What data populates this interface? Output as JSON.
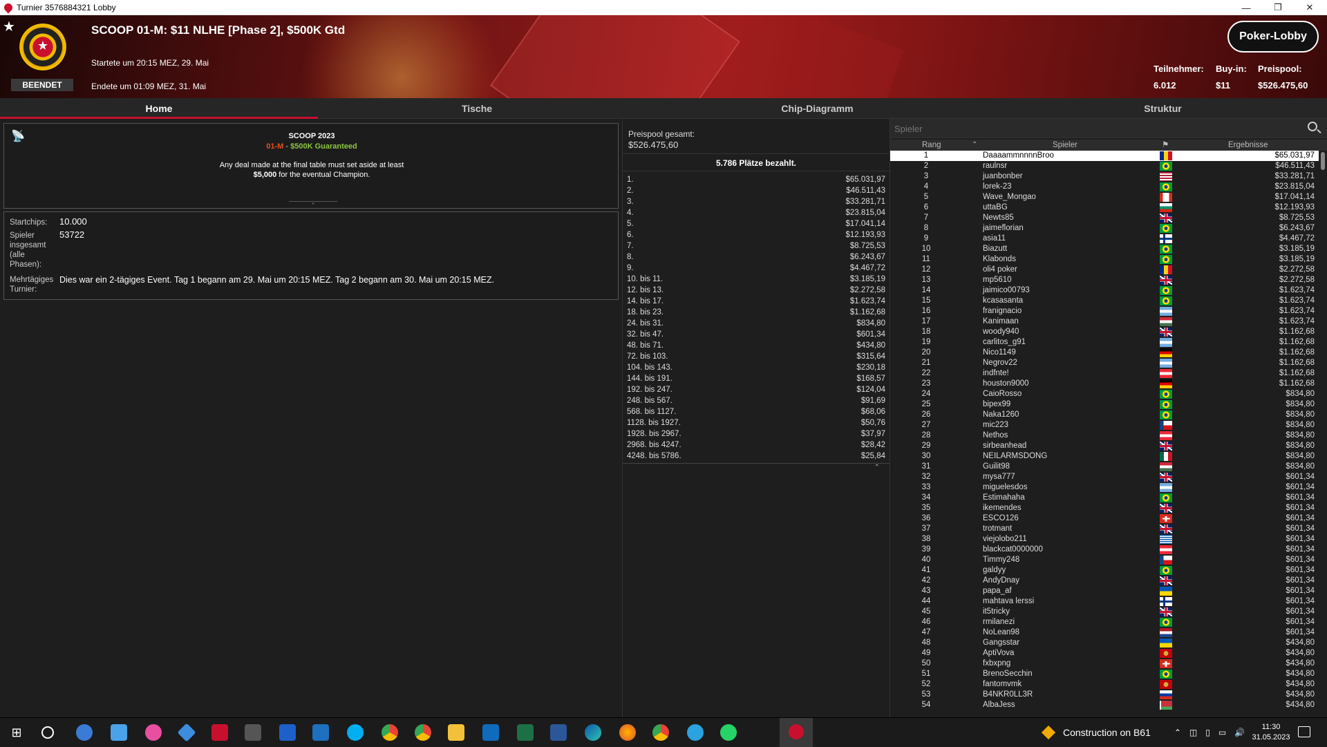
{
  "window": {
    "title": "Turnier 3576884321 Lobby"
  },
  "header": {
    "title": "SCOOP 01-M: $11 NLHE [Phase 2], $500K Gtd",
    "started": "Startete um 20:15 MEZ, 29. Mai",
    "ended": "Endete um 01:09 MEZ, 31. Mai",
    "status": "BEENDET",
    "lobby_button": "Poker-Lobby",
    "stats": {
      "players_label": "Teilnehmer:",
      "players_value": "6.012",
      "buyin_label": "Buy-in:",
      "buyin_value": "$11",
      "prizepool_label": "Preispool:",
      "prizepool_value": "$526.475,60"
    }
  },
  "tabs": [
    "Home",
    "Tische",
    "Chip-Diagramm",
    "Struktur"
  ],
  "info": {
    "line1": "SCOOP 2023",
    "line2_a": "01-M",
    "line2_b": "$500K Guaranteed",
    "line3": "Any deal made at the final table must set aside at least",
    "line4_bold": "$5,000",
    "line4_rest": " for the eventual Champion."
  },
  "details": {
    "startchips_label": "Startchips:",
    "startchips_value": "10.000",
    "players_label_1": "Spieler",
    "players_label_2": "insgesamt",
    "players_label_3": "(alle",
    "players_label_4": "Phasen):",
    "players_value": "53722",
    "multiday_label_1": "Mehrtägiges",
    "multiday_label_2": "Turnier:",
    "multiday_value": "Dies war ein 2-tägiges Event. Tag 1 begann am 29. Mai um 20:15 MEZ. Tag 2 begann am 30. Mai um 20:15 MEZ."
  },
  "prizepool": {
    "label": "Preispool gesamt:",
    "value": "$526.475,60",
    "paid": "5.786 Plätze bezahlt.",
    "rows": [
      [
        "1.",
        "$65.031,97"
      ],
      [
        "2.",
        "$46.511,43"
      ],
      [
        "3.",
        "$33.281,71"
      ],
      [
        "4.",
        "$23.815,04"
      ],
      [
        "5.",
        "$17.041,14"
      ],
      [
        "6.",
        "$12.193,93"
      ],
      [
        "7.",
        "$8.725,53"
      ],
      [
        "8.",
        "$6.243,67"
      ],
      [
        "9.",
        "$4.467,72"
      ],
      [
        "10. bis 11.",
        "$3.185,19"
      ],
      [
        "12. bis 13.",
        "$2.272,58"
      ],
      [
        "14. bis 17.",
        "$1.623,74"
      ],
      [
        "18. bis 23.",
        "$1.162,68"
      ],
      [
        "24. bis 31.",
        "$834,80"
      ],
      [
        "32. bis 47.",
        "$601,34"
      ],
      [
        "48. bis 71.",
        "$434,80"
      ],
      [
        "72. bis 103.",
        "$315,64"
      ],
      [
        "104. bis 143.",
        "$230,18"
      ],
      [
        "144. bis 191.",
        "$168,57"
      ],
      [
        "192. bis 247.",
        "$124,04"
      ],
      [
        "248. bis 567.",
        "$91,69"
      ],
      [
        "568. bis 1127.",
        "$68,06"
      ],
      [
        "1128. bis 1927.",
        "$50,76"
      ],
      [
        "1928. bis 2967.",
        "$37,97"
      ],
      [
        "2968. bis 4247.",
        "$28,42"
      ],
      [
        "4248. bis 5786.",
        "$25,84"
      ]
    ]
  },
  "players": {
    "search_placeholder": "Spieler",
    "col_rank": "Rang",
    "col_player": "Spieler",
    "col_result": "Ergebnisse",
    "rows": [
      [
        "1",
        "DaaaammnnnnBroo",
        "ro",
        "$65.031,97"
      ],
      [
        "2",
        "raulnsr",
        "br",
        "$46.511,43"
      ],
      [
        "3",
        "juanbonber",
        "us",
        "$33.281,71"
      ],
      [
        "4",
        "lorek-23",
        "br",
        "$23.815,04"
      ],
      [
        "5",
        "Wave_Mongao",
        "ca",
        "$17.041,14"
      ],
      [
        "6",
        "uttaBG",
        "bg",
        "$12.193,93"
      ],
      [
        "7",
        "Newts85",
        "gb",
        "$8.725,53"
      ],
      [
        "8",
        "jaimeflorian",
        "br",
        "$6.243,67"
      ],
      [
        "9",
        "asia11",
        "fi",
        "$4.467,72"
      ],
      [
        "10",
        "Biazutt",
        "br",
        "$3.185,19"
      ],
      [
        "11",
        "Klabonds",
        "br",
        "$3.185,19"
      ],
      [
        "12",
        "oli4 poker",
        "ro",
        "$2.272,58"
      ],
      [
        "13",
        "mp5610",
        "gb",
        "$2.272,58"
      ],
      [
        "14",
        "jaimico00793",
        "br",
        "$1.623,74"
      ],
      [
        "15",
        "kcasasanta",
        "br",
        "$1.623,74"
      ],
      [
        "16",
        "franignacio",
        "ar",
        "$1.623,74"
      ],
      [
        "17",
        "Kanimaan",
        "hu",
        "$1.623,74"
      ],
      [
        "18",
        "woody940",
        "gb",
        "$1.162,68"
      ],
      [
        "19",
        "carlitos_g91",
        "ar",
        "$1.162,68"
      ],
      [
        "20",
        "Nico1149",
        "de",
        "$1.162,68"
      ],
      [
        "21",
        "Negrov22",
        "ar",
        "$1.162,68"
      ],
      [
        "22",
        "indfnte!",
        "at",
        "$1.162,68"
      ],
      [
        "23",
        "houston9000",
        "de",
        "$1.162,68"
      ],
      [
        "24",
        "CaioRosso",
        "br",
        "$834,80"
      ],
      [
        "25",
        "bipex99",
        "br",
        "$834,80"
      ],
      [
        "26",
        "Naka1260",
        "br",
        "$834,80"
      ],
      [
        "27",
        "mic223",
        "cz",
        "$834,80"
      ],
      [
        "28",
        "Nethos",
        "at",
        "$834,80"
      ],
      [
        "29",
        "sirbeanhead",
        "gb",
        "$834,80"
      ],
      [
        "30",
        "NEILARMSDONG",
        "mx",
        "$834,80"
      ],
      [
        "31",
        "Guilit98",
        "hu",
        "$834,80"
      ],
      [
        "32",
        "mysa777",
        "gb",
        "$601,34"
      ],
      [
        "33",
        "miguelesdos",
        "ar",
        "$601,34"
      ],
      [
        "34",
        "Estimahaha",
        "br",
        "$601,34"
      ],
      [
        "35",
        "ikemendes",
        "gb",
        "$601,34"
      ],
      [
        "36",
        "ESCO126",
        "ch",
        "$601,34"
      ],
      [
        "37",
        "trotmant",
        "gb",
        "$601,34"
      ],
      [
        "38",
        "viejolobo211",
        "gr",
        "$601,34"
      ],
      [
        "39",
        "blackcat0000000",
        "at",
        "$601,34"
      ],
      [
        "40",
        "Timmy248",
        "cz",
        "$601,34"
      ],
      [
        "41",
        "galdyy",
        "br",
        "$601,34"
      ],
      [
        "42",
        "AndyDnay",
        "gb",
        "$601,34"
      ],
      [
        "43",
        "papa_af",
        "ua",
        "$601,34"
      ],
      [
        "44",
        "mahtava lerssi",
        "fi",
        "$601,34"
      ],
      [
        "45",
        "it5tricky",
        "gb",
        "$601,34"
      ],
      [
        "46",
        "rmilanezi",
        "br",
        "$601,34"
      ],
      [
        "47",
        "NoLean98",
        "nl",
        "$601,34"
      ],
      [
        "48",
        "Gangsstar",
        "ua",
        "$434,80"
      ],
      [
        "49",
        "AptiVova",
        "me",
        "$434,80"
      ],
      [
        "50",
        "fxbxpng",
        "ch",
        "$434,80"
      ],
      [
        "51",
        "BrenoSecchin",
        "br",
        "$434,80"
      ],
      [
        "52",
        "fantomvmk",
        "me",
        "$434,80"
      ],
      [
        "53",
        "B4NKR0LL3R",
        "ru",
        "$434,80"
      ],
      [
        "54",
        "AlbaJess",
        "by",
        "$434,80"
      ]
    ]
  },
  "taskbar": {
    "notification": "Construction on B61",
    "time": "11:30",
    "date": "31.05.2023"
  }
}
